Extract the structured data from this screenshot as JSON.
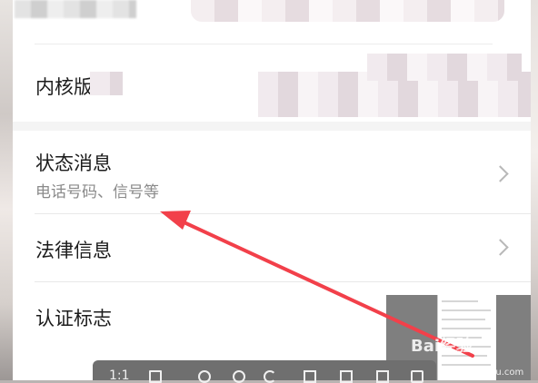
{
  "settings": {
    "items": [
      {
        "label": "内核版本",
        "subtitle": ""
      },
      {
        "label": "状态消息",
        "subtitle": "电话号码、信号等"
      },
      {
        "label": "法律信息",
        "subtitle": ""
      },
      {
        "label": "认证标志",
        "subtitle": ""
      }
    ]
  },
  "toolbar": {
    "zoom_label": "1:1",
    "icons": [
      "fit-screen-icon",
      "clock-icon",
      "zoom-out-icon",
      "rotate-icon",
      "save-icon",
      "favorite-icon",
      "copy-icon",
      "share-icon"
    ]
  },
  "watermark": {
    "brand": "Bai经验",
    "url": "jingyan.baidu.com"
  },
  "colors": {
    "annotation_arrow": "#f2404a",
    "chevron": "#b8b8b8"
  }
}
